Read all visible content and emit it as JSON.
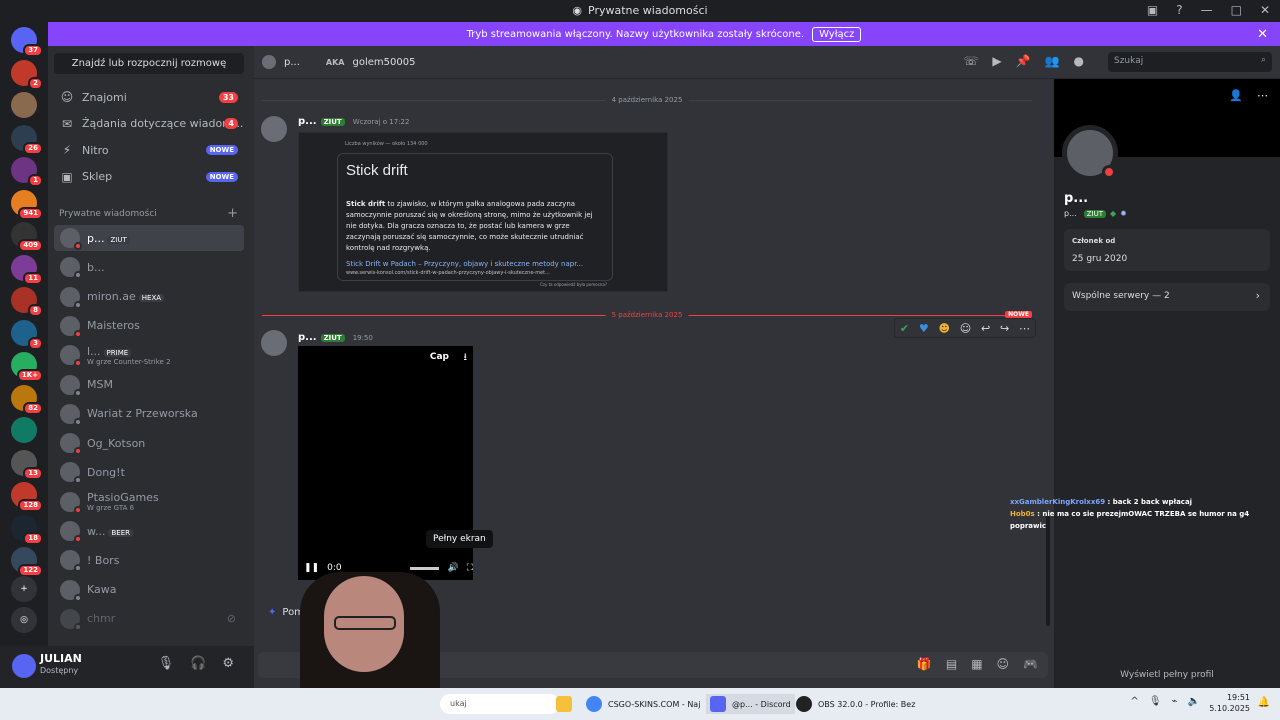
{
  "titlebar": {
    "title": "Prywatne wiadomości"
  },
  "stream_banner": {
    "text": "Tryb streamowania włączony. Nazwy użytkownika zostały skrócone.",
    "button": "Wyłącz"
  },
  "servers": [
    {
      "badge": "37"
    },
    {
      "badge": "2"
    },
    {
      "badge": ""
    },
    {
      "badge": "26"
    },
    {
      "badge": "1"
    },
    {
      "badge": "941"
    },
    {
      "badge": "409"
    },
    {
      "badge": "11"
    },
    {
      "badge": "8"
    },
    {
      "badge": "3"
    },
    {
      "badge": "1K+"
    },
    {
      "badge": "82"
    },
    {
      "badge": ""
    },
    {
      "badge": "13"
    },
    {
      "badge": "128"
    },
    {
      "badge": "18"
    },
    {
      "badge": "122"
    }
  ],
  "dm_panel": {
    "search_button": "Znajdź lub rozpocznij rozmowę",
    "nav": [
      {
        "label": "Znajomi",
        "count": "33",
        "icon": "friends-icon"
      },
      {
        "label": "Żądania dotyczące wiadom...",
        "count": "4",
        "icon": "envelope-icon"
      },
      {
        "label": "Nitro",
        "count": "NOWE",
        "icon": "nitro-icon"
      },
      {
        "label": "Sklep",
        "count": "NOWE",
        "icon": "shop-icon"
      }
    ],
    "section_header": "Prywatne wiadomości",
    "dms": [
      {
        "name": "p...",
        "tag": "ZIUT",
        "sub": ""
      },
      {
        "name": "b...",
        "tag": "",
        "sub": ""
      },
      {
        "name": "miron.ae",
        "tag": "HEXA",
        "sub": ""
      },
      {
        "name": "Maisteros",
        "tag": "",
        "sub": ""
      },
      {
        "name": "l...",
        "tag": "PRIME",
        "sub": "W grze Counter-Strike 2"
      },
      {
        "name": "MSM",
        "tag": "",
        "sub": ""
      },
      {
        "name": "Wariat z Przeworska",
        "tag": "",
        "sub": ""
      },
      {
        "name": "Og_Kotson",
        "tag": "",
        "sub": ""
      },
      {
        "name": "Dong!t",
        "tag": "",
        "sub": ""
      },
      {
        "name": "PtasioGames",
        "tag": "",
        "sub": "W grze GTA 6"
      },
      {
        "name": "w...",
        "tag": "BEER",
        "sub": ""
      },
      {
        "name": "! Bors",
        "tag": "",
        "sub": ""
      },
      {
        "name": "Kawa",
        "tag": "",
        "sub": ""
      },
      {
        "name": "chmr",
        "tag": "",
        "sub": ""
      }
    ]
  },
  "user": {
    "name": "JULIAN",
    "status": "Dostępny"
  },
  "chat_header": {
    "name": "p...",
    "aka": "AKA",
    "alias": "golem50005",
    "search_placeholder": "Szukaj"
  },
  "dividers": {
    "first": "4 października 2025",
    "second": "5 października 2025",
    "new_label": "NOWE"
  },
  "messages": [
    {
      "author": "p...",
      "tag": "ZIUT",
      "time": "Wczoraj o 17:22"
    },
    {
      "author": "p...",
      "tag": "ZIUT",
      "time": "19:50"
    }
  ],
  "embed": {
    "meta": "Liczba wyników — około 134 000",
    "title": "Stick drift",
    "bold": "Stick drift",
    "body": " to zjawisko, w którym gałka analogowa pada zaczyna samoczynnie poruszać się w określoną stronę, mimo że użytkownik jej nie dotyka. Dla gracza oznacza to, że postać lub kamera w grze zaczynają poruszać się samoczynnie, co może skutecznie utrudniać kontrolę nad rozgrywką.",
    "link": "Stick Drift w Padach – Przyczyny, objawy i skuteczne metody napr...",
    "url": "www.serwis-konsol.com/stick-drift-w-padach-przyczyny-objawy-i-skuteczne-met...",
    "foot": "Czy ta odpowiedź była pomocna?"
  },
  "video": {
    "brand": "Cap",
    "time": "0:0",
    "tooltip": "Pełny ekran"
  },
  "pomaga": "Poma",
  "profile": {
    "name": "p...",
    "tag_prefix": "p...",
    "tag": "ZIUT",
    "member_label": "Członek od",
    "member_since": "25 gru 2020",
    "shared": "Wspólne serwery — 2",
    "full_profile": "Wyświetl pełny profil"
  },
  "overlay_chat": [
    {
      "user": "xxGamblerKingKrolxx69",
      "text": " : back 2 back wpłacaj"
    },
    {
      "user": "Hob0s",
      "text": " : nie ma co sie prezejmOWAC TRZEBA se humor na g4 poprawic"
    }
  ],
  "taskbar": {
    "search": "ukaj",
    "items": [
      "CSGO-SKINS.COM - Naj",
      "@p... - Discord",
      "OBS 32.0.0 - Profile: Bez"
    ],
    "time": "19:51",
    "date": "5.10.2025"
  },
  "colors": {
    "accent": "#5865f2",
    "stream": "#8644fb",
    "danger": "#f23f43",
    "online": "#23a55a"
  }
}
